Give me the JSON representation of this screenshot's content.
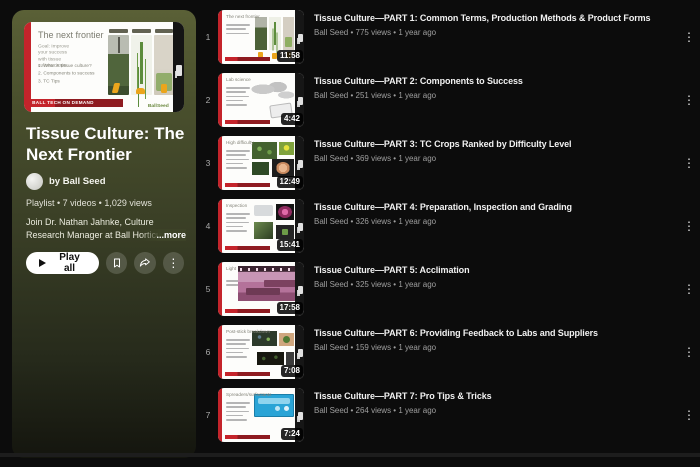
{
  "playlist": {
    "title": "Tissue Culture: The Next Frontier",
    "byline": "by Ball Seed",
    "meta": "Playlist • 7 videos • 1,029 views",
    "description": "Join Dr. Nathan Jahnke, Culture Research Manager at Ball Horticultural Company and Deanna Felton, longtim",
    "more_label": "...more",
    "play_all_label": "Play all",
    "thumbnail": {
      "slide_title": "The next frontier",
      "subtitle": "Goal: Improve your success with tissue culture crops.",
      "bullets": [
        "1.  What is tissue culture?",
        "2.  Components to success",
        "3.  TC Tips"
      ],
      "brand": "BALL TECH ON DEMAND",
      "logo": "BallSeed"
    }
  },
  "videos": [
    {
      "index": "1",
      "title": "Tissue Culture—PART 1: Common Terms, Production Methods & Product Forms",
      "meta": "Ball Seed • 775 views • 1 year ago",
      "duration": "11:58",
      "slide_title": "The next frontier"
    },
    {
      "index": "2",
      "title": "Tissue Culture—PART 2: Components to Success",
      "meta": "Ball Seed • 251 views • 1 year ago",
      "duration": "4:42",
      "slide_title": "Lab science"
    },
    {
      "index": "3",
      "title": "Tissue Culture—PART 3: TC Crops Ranked by Difficulty Level",
      "meta": "Ball Seed • 369 views • 1 year ago",
      "duration": "12:49",
      "slide_title": "High difficulty"
    },
    {
      "index": "4",
      "title": "Tissue Culture—PART 4: Preparation, Inspection and Grading",
      "meta": "Ball Seed • 326 views • 1 year ago",
      "duration": "15:41",
      "slide_title": "Inspection"
    },
    {
      "index": "5",
      "title": "Tissue Culture—PART 5: Acclimation",
      "meta": "Ball Seed • 325 views • 1 year ago",
      "duration": "17:58",
      "slide_title": "Light"
    },
    {
      "index": "6",
      "title": "Tissue Culture—PART 6: Providing Feedback to Labs and Suppliers",
      "meta": "Ball Seed • 159 views • 1 year ago",
      "duration": "7:08",
      "slide_title": "Post-stick breakdown"
    },
    {
      "index": "7",
      "title": "Tissue Culture—PART 7: Pro Tips & Tricks",
      "meta": "Ball Seed • 264 views • 1 year ago",
      "duration": "7:24",
      "slide_title": "Spreaders/surfactants"
    }
  ],
  "colors": {
    "accent_red": "#c4242b",
    "figure_orange": "#eba51c",
    "sidebar_green_top": "#5a6036",
    "sidebar_green_bottom": "#14150e",
    "magenta_photo": "#b4729a",
    "blue_slide": "#2aa4d6",
    "page_background": "#0c0c0c"
  }
}
